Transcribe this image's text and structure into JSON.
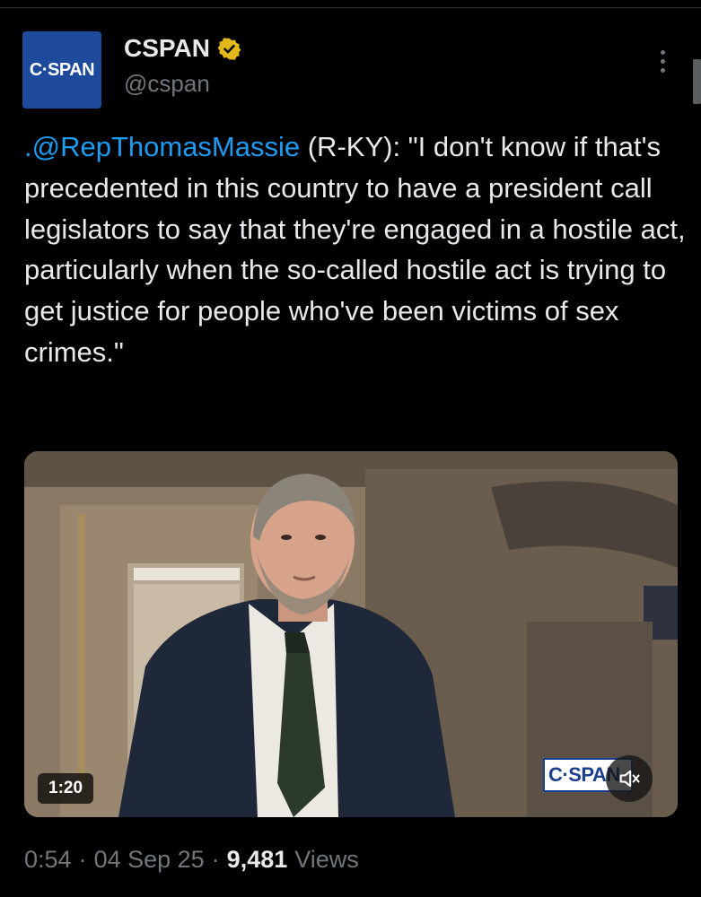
{
  "account": {
    "avatar_text": "C·SPAN",
    "display_name": "CSPAN",
    "handle": "@cspan"
  },
  "tweet": {
    "mention": ".@RepThomasMassie",
    "body": " (R-KY): \"I don't know if that's precedented in this country to have a president call legislators to say that they're engaged in a hostile act, particularly when the so-called hostile act is trying to get justice for people who've been victims of sex crimes.\""
  },
  "media": {
    "duration": "1:20",
    "watermark": "C·SPAN"
  },
  "meta": {
    "time": "0:54",
    "date": "04 Sep 25",
    "views_count": "9,481",
    "views_label": "Views"
  },
  "colors": {
    "background": "#000000",
    "text": "#e7e9ea",
    "secondary": "#71767b",
    "link": "#1d9bf0",
    "badge_gold": "#e2b719",
    "brand_blue": "#1d4a9a"
  },
  "icons": {
    "verified": "verified-badge-icon",
    "more": "more-vertical-icon",
    "mute": "volume-muted-icon"
  }
}
